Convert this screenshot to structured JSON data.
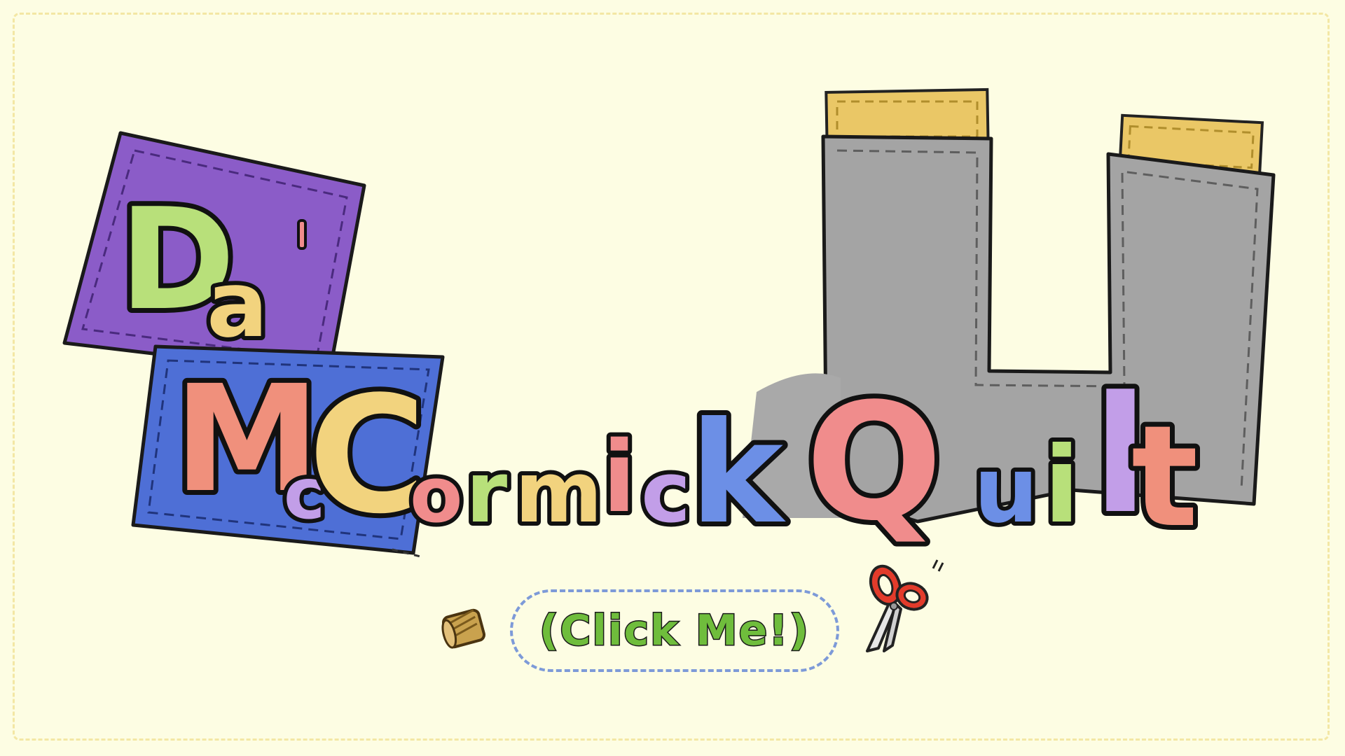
{
  "title": {
    "word1": [
      "D",
      "a"
    ],
    "word2": [
      "M",
      "c",
      "C",
      "o",
      "r",
      "m",
      "i",
      "c",
      "k"
    ],
    "word3": [
      "Q",
      "u",
      "i",
      "l",
      "t"
    ]
  },
  "button": {
    "label": "(Click Me!)"
  },
  "icons": {
    "spool": "thread-spool-icon",
    "scissors": "scissors-icon"
  },
  "colors": {
    "background": "#fdfde3",
    "purple_patch": "#8b5cc8",
    "blue_patch": "#4e6fd6",
    "gray_patch": "#a4a4a4",
    "yellow_patch": "#eac766",
    "green": "#b8e07a",
    "salmon": "#f0907c",
    "yellow": "#f2d37e",
    "pink": "#f08c8c",
    "lilac": "#c29ee8",
    "blue": "#6c8fe6",
    "red": "#e56a6a",
    "button_text": "#6fbd3c",
    "button_border": "#7d9ad8"
  }
}
